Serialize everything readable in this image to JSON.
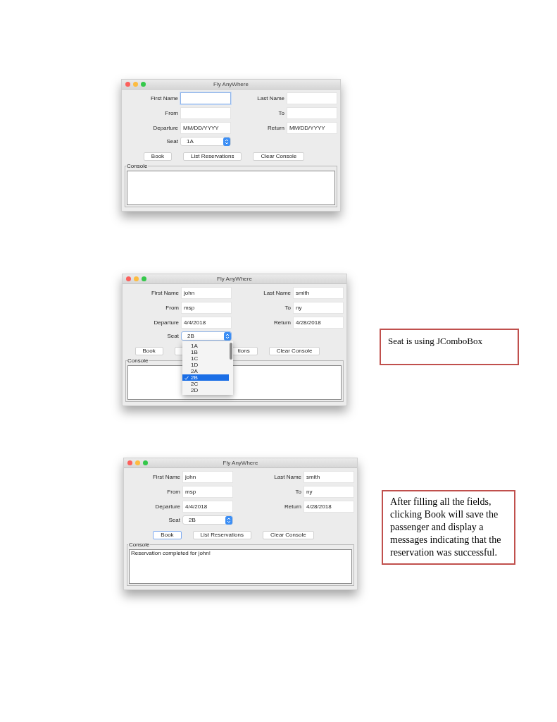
{
  "windows": [
    {
      "title": "Fly AnyWhere",
      "fields": [
        {
          "label": "First Name",
          "focused": true
        },
        {
          "label": "Last Name",
          "focused": false
        },
        {
          "label": "From",
          "focused": false
        },
        {
          "label": "To",
          "focused": false
        },
        {
          "label": "Departure",
          "value": "MM/DD/YYYY",
          "focused": false
        },
        {
          "label": "Return",
          "value": "MM/DD/YYYY",
          "focused": false
        }
      ],
      "seat": {
        "label": "Seat",
        "value": "1A",
        "focused": false
      },
      "buttons": [
        {
          "label": "Book",
          "focused": false,
          "cut": false
        },
        {
          "label": "List Reservations",
          "focused": false,
          "cut": false
        },
        {
          "label": "Clear Console",
          "focused": false,
          "cut": false
        }
      ],
      "console": {
        "label": "Console"
      }
    },
    {
      "title": "Fly AnyWhere",
      "fields": [
        {
          "label": "First Name",
          "value": "john",
          "focused": false
        },
        {
          "label": "Last Name",
          "value": "smith",
          "focused": false
        },
        {
          "label": "From",
          "value": "msp",
          "focused": false
        },
        {
          "label": "To",
          "value": "ny",
          "focused": false
        },
        {
          "label": "Departure",
          "value": "4/4/2018",
          "focused": false
        },
        {
          "label": "Return",
          "value": "4/28/2018",
          "focused": false
        }
      ],
      "seat": {
        "label": "Seat",
        "value": "2B",
        "focused": true,
        "options": [
          {
            "label": "1A",
            "selected": false
          },
          {
            "label": "1B",
            "selected": false
          },
          {
            "label": "1C",
            "selected": false
          },
          {
            "label": "1D",
            "selected": false
          },
          {
            "label": "2A",
            "selected": false
          },
          {
            "label": "2B",
            "selected": true
          },
          {
            "label": "2C",
            "selected": false
          },
          {
            "label": "2D",
            "selected": false
          }
        ]
      },
      "buttons": [
        {
          "label": "Book",
          "focused": false,
          "cut": false
        },
        {
          "label": "tions",
          "focused": false,
          "cut": true
        },
        {
          "label": "Clear Console",
          "focused": false,
          "cut": false
        }
      ],
      "console": {
        "label": "Console"
      },
      "note": "Seat is using JComboBox"
    },
    {
      "title": "Fly AnyWhere",
      "fields": [
        {
          "label": "First Name",
          "value": "john",
          "focused": false
        },
        {
          "label": "Last Name",
          "value": "smith",
          "focused": false
        },
        {
          "label": "From",
          "value": "msp",
          "focused": false
        },
        {
          "label": "To",
          "value": "ny",
          "focused": false
        },
        {
          "label": "Departure",
          "value": "4/4/2018",
          "focused": false
        },
        {
          "label": "Return",
          "value": "4/28/2018",
          "focused": false
        }
      ],
      "seat": {
        "label": "Seat",
        "value": "2B",
        "focused": false
      },
      "buttons": [
        {
          "label": "Book",
          "focused": true,
          "cut": false
        },
        {
          "label": "List Reservations",
          "focused": false,
          "cut": false
        },
        {
          "label": "Clear Console",
          "focused": false,
          "cut": false
        }
      ],
      "console": {
        "label": "Console",
        "lines": [
          "Reservation completed for john!"
        ]
      },
      "note": "After filling all the fields, clicking Book will save the passenger and display a messages indicating that the reservation was successful."
    }
  ]
}
